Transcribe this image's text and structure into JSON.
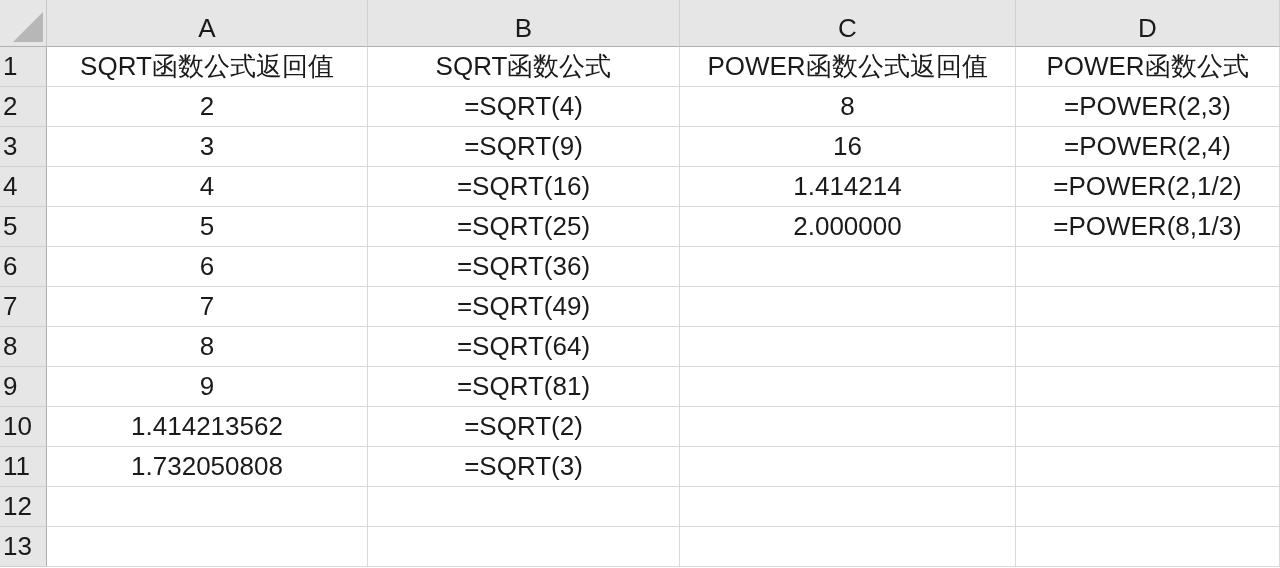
{
  "sheet": {
    "columns": [
      "A",
      "B",
      "C",
      "D"
    ],
    "rows": [
      {
        "number": "1",
        "cells": [
          "SQRT函数公式返回值",
          "SQRT函数公式",
          "POWER函数公式返回值",
          "POWER函数公式"
        ]
      },
      {
        "number": "2",
        "cells": [
          "2",
          "=SQRT(4)",
          "8",
          "=POWER(2,3)"
        ]
      },
      {
        "number": "3",
        "cells": [
          "3",
          "=SQRT(9)",
          "16",
          "=POWER(2,4)"
        ]
      },
      {
        "number": "4",
        "cells": [
          "4",
          "=SQRT(16)",
          "1.414214",
          "=POWER(2,1/2)"
        ]
      },
      {
        "number": "5",
        "cells": [
          "5",
          "=SQRT(25)",
          "2.000000",
          "=POWER(8,1/3)"
        ]
      },
      {
        "number": "6",
        "cells": [
          "6",
          "=SQRT(36)",
          null,
          null
        ]
      },
      {
        "number": "7",
        "cells": [
          "7",
          "=SQRT(49)",
          null,
          null
        ]
      },
      {
        "number": "8",
        "cells": [
          "8",
          "=SQRT(64)",
          null,
          null
        ]
      },
      {
        "number": "9",
        "cells": [
          "9",
          "=SQRT(81)",
          null,
          null
        ]
      },
      {
        "number": "10",
        "cells": [
          "1.414213562",
          "=SQRT(2)",
          null,
          null
        ]
      },
      {
        "number": "11",
        "cells": [
          "1.732050808",
          "=SQRT(3)",
          null,
          null
        ]
      },
      {
        "number": "12",
        "cells": [
          null,
          null,
          null,
          null
        ]
      },
      {
        "number": "13",
        "cells": [
          null,
          null,
          null,
          null
        ]
      }
    ]
  }
}
